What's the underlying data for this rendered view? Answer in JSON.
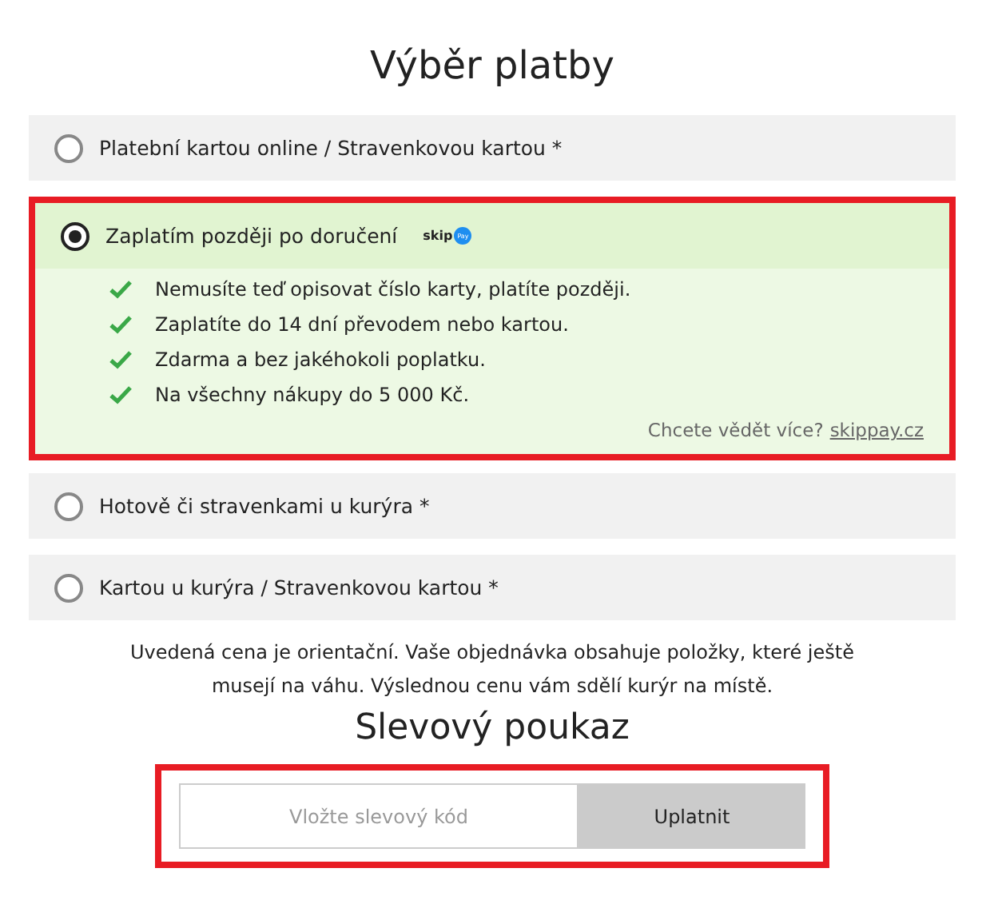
{
  "title": "Výběr platby",
  "payment_options": [
    {
      "label": "Platební kartou online / Stravenkovou kartou *",
      "selected": false,
      "highlighted": false
    },
    {
      "label": "Zaplatím později po doručení",
      "selected": true,
      "highlighted": true,
      "logo": {
        "word": "skip",
        "badge": "Pay"
      },
      "benefits": [
        "Nemusíte teď opisovat číslo karty, platíte později.",
        "Zaplatíte do 14 dní převodem nebo kartou.",
        "Zdarma a bez jakéhokoli poplatku.",
        "Na všechny nákupy do 5 000 Kč."
      ],
      "more_info": {
        "text": "Chcete vědět více?",
        "link": "skippay.cz"
      }
    },
    {
      "label": "Hotově či stravenkami u kurýra *",
      "selected": false,
      "highlighted": false
    },
    {
      "label": "Kartou u kurýra / Stravenkovou kartou *",
      "selected": false,
      "highlighted": false
    }
  ],
  "note": "Uvedená cena je orientační. Vaše objednávka obsahuje položky, které ještě musejí na váhu. Výslednou cenu vám sdělí kurýr na místě.",
  "coupon": {
    "title": "Slevový poukaz",
    "highlighted": true,
    "placeholder": "Vložte slevový kód",
    "button": "Uplatnit"
  }
}
